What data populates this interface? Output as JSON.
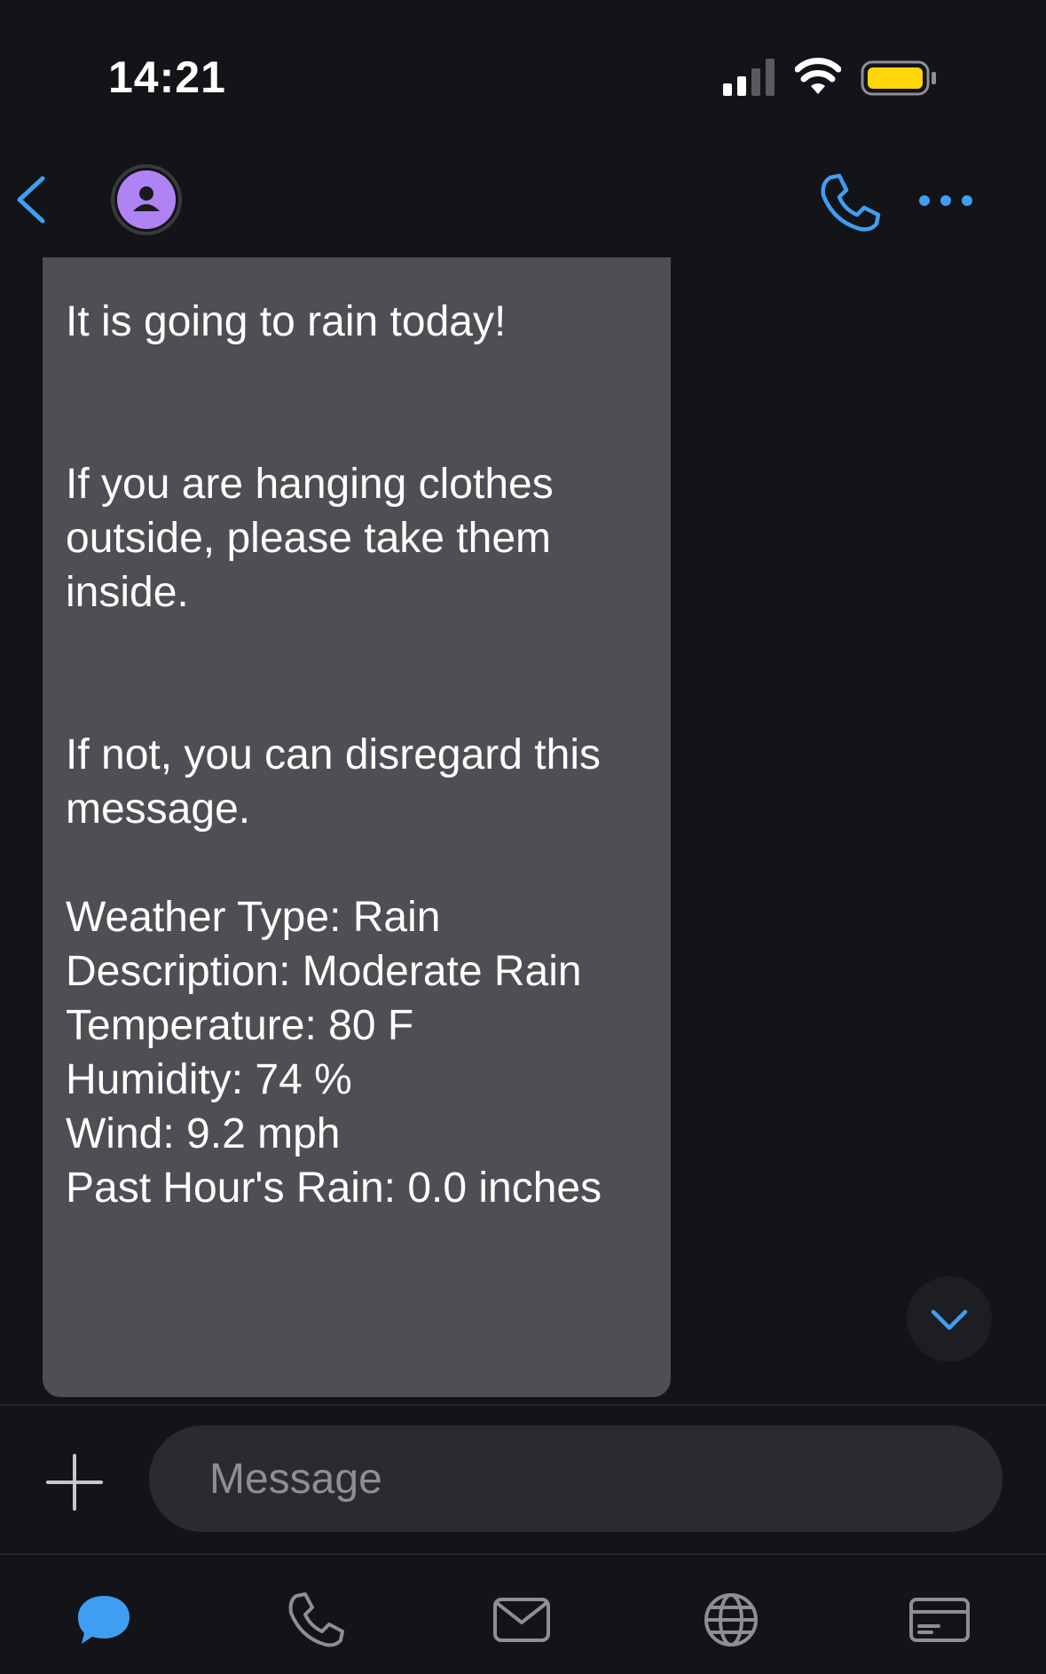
{
  "status_bar": {
    "time": "14:21",
    "icons": [
      "cellular-signal-icon",
      "wifi-icon",
      "battery-icon"
    ],
    "battery_color": "#ffd60a"
  },
  "nav": {
    "back_icon": "chevron-left-icon",
    "avatar_color": "#b083f4",
    "call_icon": "phone-icon",
    "more_icon": "ellipsis-icon",
    "accent_color": "#3f9ef2"
  },
  "message": {
    "line_1": "It is going to rain today!",
    "line_2": "If you are hanging clothes",
    "line_3": "outside, please take them",
    "line_4": "inside.",
    "line_5": "If not, you can disregard this",
    "line_6": "message.",
    "weather_type": "Weather Type: Rain",
    "description": "Description: Moderate Rain",
    "temperature": "Temperature: 80 F",
    "humidity": "Humidity: 74 %",
    "wind": "Wind: 9.2 mph",
    "past_hour_rain": "Past Hour's Rain: 0.0 inches",
    "bubble_color": "#4e4e53"
  },
  "composer": {
    "placeholder": "Message",
    "plus_icon": "plus-icon"
  },
  "tab_bar": {
    "tabs": [
      "chat-bubble-icon",
      "phone-icon",
      "mail-icon",
      "globe-icon",
      "card-icon"
    ],
    "active_tab": "chat-bubble-icon"
  }
}
